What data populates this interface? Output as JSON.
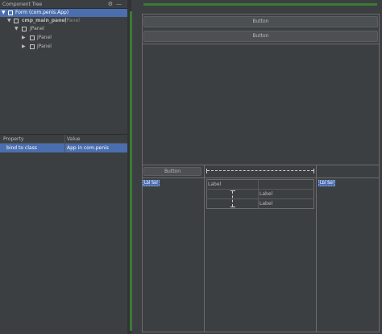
{
  "component_tree": {
    "title": "Component Tree",
    "items": [
      {
        "label": "Form (com.penis.App)",
        "sub": ""
      },
      {
        "label": "cmp_main_panel",
        "sub": " : JPanel"
      },
      {
        "label": "JPanel",
        "sub": ""
      },
      {
        "label": "JPanel",
        "sub": ""
      },
      {
        "label": "JPanel",
        "sub": ""
      }
    ]
  },
  "properties": {
    "col_property": "Property",
    "col_value": "Value",
    "row_name": "bind to class",
    "row_value": "App in com.penis"
  },
  "designer": {
    "button1": "Button",
    "button2": "Button",
    "button3": "Button",
    "label_a": "Label",
    "label_b": "Label",
    "label_c": "Label",
    "selected_left": "Lbl Sel",
    "selected_right": "Lbl Sel"
  },
  "colors": {
    "accent": "#4b6eaf",
    "green": "#3c7a35",
    "background": "#3c3f41"
  }
}
